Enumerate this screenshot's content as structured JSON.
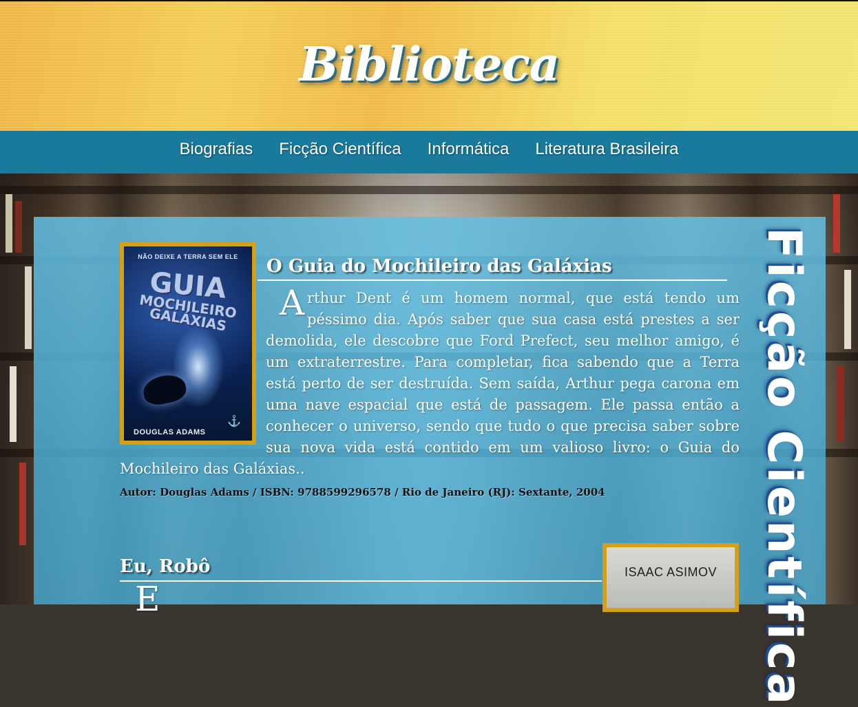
{
  "header": {
    "title": "Biblioteca"
  },
  "nav": {
    "items": [
      {
        "label": "Biografias"
      },
      {
        "label": "Ficção Científica"
      },
      {
        "label": "Informática"
      },
      {
        "label": "Literatura Brasileira"
      }
    ]
  },
  "section": {
    "title": "Ficção Científica"
  },
  "books": [
    {
      "title": "O Guia do Mochileiro das Galáxias",
      "description_first_letter": "A",
      "description_rest": "rthur Dent é um homem normal, que está tendo um péssimo dia. Após saber que sua casa está prestes a ser demolida, ele descobre que Ford Prefect, seu melhor amigo, é um extraterrestre. Para completar, fica sabendo que a Terra está perto de ser destruída. Sem saída, Arthur pega carona em uma nave espacial que está de passagem. Ele passa então a conhecer o universo, sendo que tudo o que precisa saber sobre sua nova vida está contido em um valioso livro: o Guia do Mochileiro das Galáxias..",
      "meta": "Autor: Douglas Adams / ISBN: 9788599296578 / Rio de Janeiro (RJ): Sextante, 2004",
      "cover": {
        "tagline": "NÃO DEIXE A TERRA SEM ELE",
        "title_line1": "GUIA",
        "title_line2": "MOCHILEIRO",
        "title_line3": "GALÁXIAS",
        "author": "DOUGLAS ADAMS"
      }
    },
    {
      "title": "Eu, Robô",
      "description_first_letter": "E",
      "cover": {
        "author": "ISAAC ASIMOV"
      }
    }
  ],
  "colors": {
    "nav_bg": "#1a7a9c",
    "panel_bg": "#5fb8dc",
    "cover_border": "#d4a017",
    "title_shadow": "#1d4f9a"
  }
}
